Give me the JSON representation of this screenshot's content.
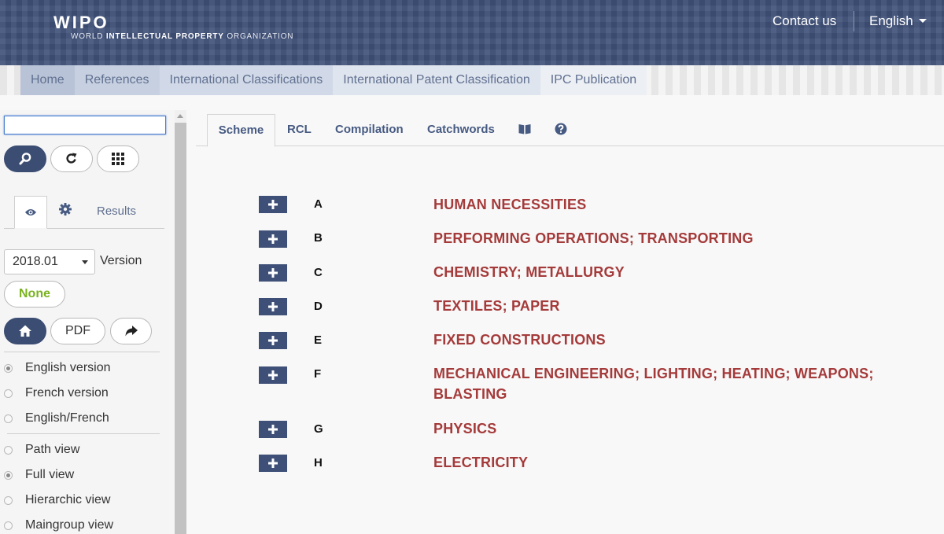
{
  "header": {
    "logo": "WIPO",
    "logo_sub_1": "WORLD ",
    "logo_sub_2": "INTELLECTUAL PROPERTY",
    "logo_sub_3": " ORGANIZATION",
    "contact": "Contact us",
    "language": "English"
  },
  "breadcrumb": [
    "Home",
    "References",
    "International Classifications",
    "International Patent Classification",
    "IPC Publication"
  ],
  "sidebar": {
    "search_value": "",
    "tabs": {
      "results": "Results"
    },
    "version_value": "2018.01",
    "version_label": "Version",
    "none_label": "None",
    "pdf_label": "PDF",
    "language_options": [
      {
        "label": "English version",
        "selected": true
      },
      {
        "label": "French version",
        "selected": false
      },
      {
        "label": "English/French",
        "selected": false
      }
    ],
    "view_options": [
      {
        "label": "Path view",
        "selected": false
      },
      {
        "label": "Full view",
        "selected": true
      },
      {
        "label": "Hierarchic view",
        "selected": false
      },
      {
        "label": "Maingroup view",
        "selected": false
      }
    ]
  },
  "main_tabs": [
    "Scheme",
    "RCL",
    "Compilation",
    "Catchwords"
  ],
  "sections": [
    {
      "symbol": "A",
      "title": "HUMAN NECESSITIES"
    },
    {
      "symbol": "B",
      "title": "PERFORMING OPERATIONS; TRANSPORTING"
    },
    {
      "symbol": "C",
      "title": "CHEMISTRY; METALLURGY"
    },
    {
      "symbol": "D",
      "title": "TEXTILES; PAPER"
    },
    {
      "symbol": "E",
      "title": "FIXED CONSTRUCTIONS"
    },
    {
      "symbol": "F",
      "title": "MECHANICAL ENGINEERING; LIGHTING; HEATING; WEAPONS; BLASTING"
    },
    {
      "symbol": "G",
      "title": "PHYSICS"
    },
    {
      "symbol": "H",
      "title": "ELECTRICITY"
    }
  ],
  "colors": {
    "header_bg": "#3f5078",
    "button_dark": "#3b4d72",
    "section_title": "#a53a3a",
    "tab_text": "#465a82",
    "none_green": "#7ab21f"
  },
  "icons": [
    "search-icon",
    "refresh-icon",
    "grid-icon",
    "eye-icon",
    "gear-icon",
    "home-icon",
    "share-icon",
    "book-icon",
    "help-icon",
    "plus-icon",
    "chevron-down-icon"
  ]
}
